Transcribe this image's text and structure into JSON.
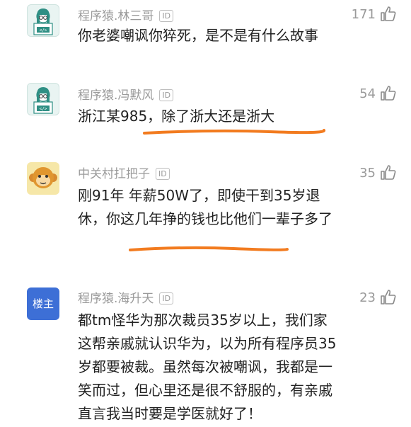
{
  "comments": [
    {
      "user": "程序猿.林三哥",
      "id_badge": "ID",
      "likes": "171",
      "text": "你老婆嘲讽你猝死，是不是有什么故事"
    },
    {
      "user": "程序猿.冯默风",
      "id_badge": "ID",
      "likes": "54",
      "text": "浙江某985，除了浙大还是浙大"
    },
    {
      "user": "中关村扛把子",
      "id_badge": "ID",
      "likes": "35",
      "text": "刚91年 年薪50W了，即使干到35岁退休，你这几年挣的钱也比他们一辈子多了"
    },
    {
      "user": "程序猿.海升天",
      "id_badge": "ID",
      "likes": "23",
      "avatar_label": "楼主",
      "text": "都tm怪华为那次裁员35岁以上，我们家这帮亲戚就认识华为，以为所有程序员35岁都要被裁。虽然每次被嘲讽，我都是一笑而过，但心里还是很不舒服的，有亲戚直言我当时要是学医就好了！"
    }
  ],
  "icons": {
    "like": "thumbs-up-icon",
    "avatar_coder": "programmer-avatar-icon",
    "avatar_monkey": "monkey-avatar-icon"
  },
  "colors": {
    "underline": "#f27b1f",
    "meta": "#9a9a9a",
    "text": "#222222",
    "host_badge": "#3d6fd6"
  }
}
